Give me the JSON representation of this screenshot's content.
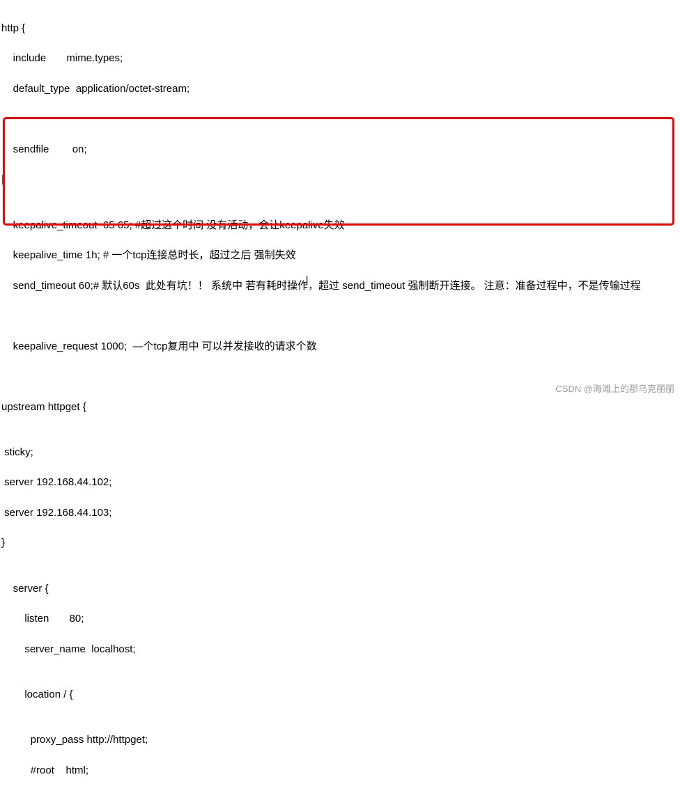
{
  "config": {
    "lines": [
      "http {",
      "    include       mime.types;",
      "    default_type  application/octet-stream;",
      "",
      "",
      "    sendfile        on;",
      "|",
      "",
      "    keepalive_timeout  65 65; #超过这个时间 没有活动，会让keepalive失效",
      "    keepalive_time 1h; # 一个tcp连接总时长，超过之后 强制失效",
      "    send_timeout 60;# 默认60s  此处有坑！！ 系统中 若有耗时操作，超过 send_timeout 强制断开连接。 注意：准备过程中，不是传输过程",
      "",
      "",
      "    keepalive_request 1000;  —个tcp复用中 可以并发接收的请求个数",
      "",
      "",
      "upstream httpget {",
      "",
      " sticky;",
      " server 192.168.44.102;",
      " server 192.168.44.103;",
      "}",
      "",
      "    server {",
      "        listen       80;",
      "        server_name  localhost;",
      "",
      "        location / {",
      "",
      "          proxy_pass http://httpget;",
      "          #root    html;"
    ]
  },
  "cursor_glyph": "I",
  "watermark": "CSDN @海滩上的那乌克丽丽"
}
